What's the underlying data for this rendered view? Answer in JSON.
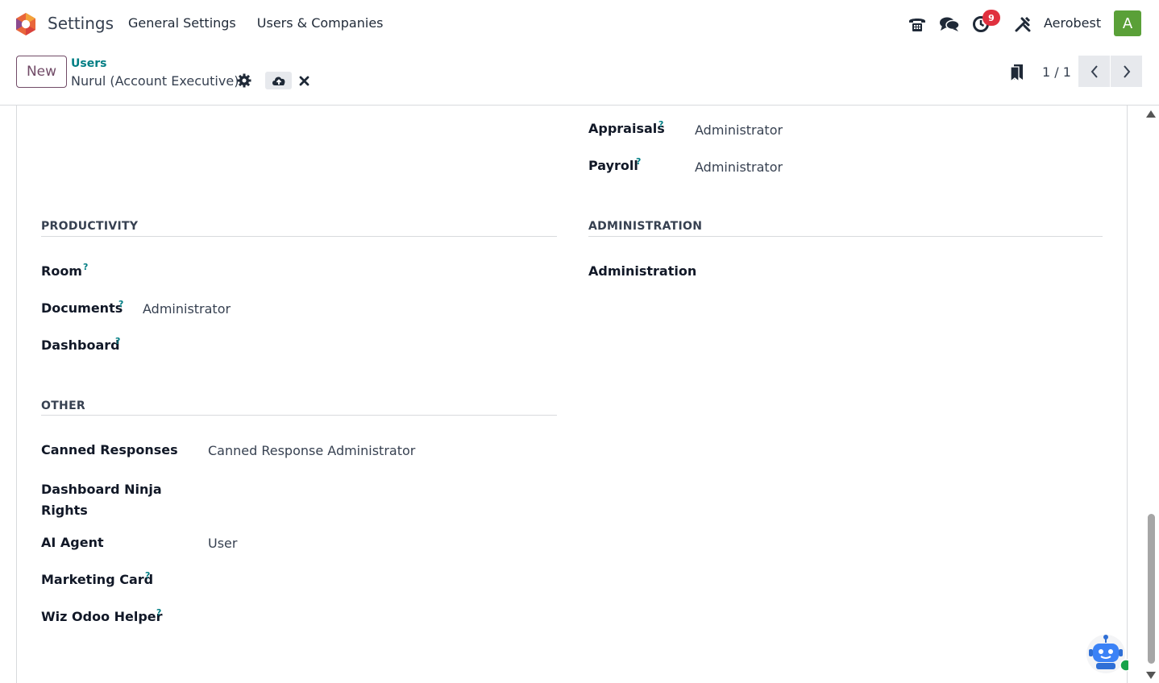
{
  "navbar": {
    "app_title": "Settings",
    "menu": [
      "General Settings",
      "Users & Companies"
    ],
    "activity_count": "9",
    "company": "Aerobest",
    "avatar_letter": "A"
  },
  "control": {
    "new_label": "New",
    "breadcrumb": "Users",
    "record_name": "Nurul (Account Executive)",
    "pager": "1 / 1"
  },
  "help_mark": "?",
  "top_fields": [
    {
      "label": "Appraisals",
      "value": "Administrator"
    },
    {
      "label": "Payroll",
      "value": "Administrator"
    }
  ],
  "productivity": {
    "title": "PRODUCTIVITY",
    "fields": [
      {
        "label": "Room",
        "value": ""
      },
      {
        "label": "Documents",
        "value": "Administrator"
      },
      {
        "label": "Dashboard",
        "value": ""
      }
    ]
  },
  "administration": {
    "title": "ADMINISTRATION",
    "field_label": "Administration"
  },
  "other": {
    "title": "OTHER",
    "fields": [
      {
        "label": "Canned Responses",
        "value": "Canned Response Administrator"
      },
      {
        "label": "Dashboard Ninja Rights",
        "value": ""
      },
      {
        "label": "AI Agent",
        "value": "User"
      },
      {
        "label": "Marketing Card",
        "value": ""
      },
      {
        "label": "Wiz Odoo Helper",
        "value": ""
      }
    ]
  },
  "colors": {
    "brand": "#714b67",
    "accent": "#017e84",
    "badge": "#e0303e",
    "avatar": "#5aa038"
  }
}
